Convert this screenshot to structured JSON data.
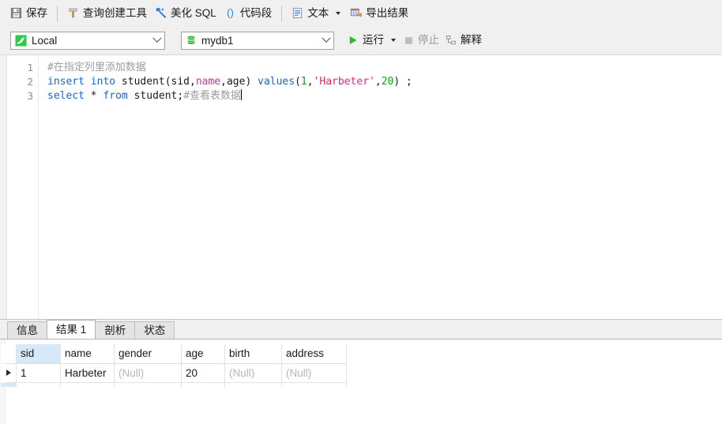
{
  "toolbar": {
    "items": [
      {
        "icon": "save-icon",
        "label": "保存"
      },
      {
        "icon": "query-builder-icon",
        "label": "查询创建工具"
      },
      {
        "icon": "beautify-icon",
        "label": "美化 SQL"
      },
      {
        "icon": "code-snippet-icon",
        "label": "代码段"
      },
      {
        "icon": "text-icon",
        "label": "文本"
      },
      {
        "icon": "export-result-icon",
        "label": "导出结果"
      }
    ]
  },
  "connection_bar": {
    "connection": {
      "icon": "mysql-dolphin-icon",
      "value": "Local"
    },
    "database": {
      "icon": "database-icon",
      "value": "mydb1"
    },
    "run_label": "运行",
    "stop_label": "停止",
    "explain_label": "解释"
  },
  "editor": {
    "line_numbers": [
      "1",
      "2",
      "3"
    ],
    "lines": [
      {
        "tokens": [
          {
            "t": "#在指定列里添加数据",
            "c": "comment"
          }
        ]
      },
      {
        "tokens": [
          {
            "t": "insert into",
            "c": "kw"
          },
          {
            "t": " student(sid,",
            "c": "plain"
          },
          {
            "t": "name",
            "c": "id"
          },
          {
            "t": ",age) ",
            "c": "plain"
          },
          {
            "t": "values",
            "c": "kw"
          },
          {
            "t": "(",
            "c": "plain"
          },
          {
            "t": "1",
            "c": "num"
          },
          {
            "t": ",",
            "c": "plain"
          },
          {
            "t": "'Harbeter'",
            "c": "str"
          },
          {
            "t": ",",
            "c": "plain"
          },
          {
            "t": "20",
            "c": "num"
          },
          {
            "t": ") ;",
            "c": "plain"
          }
        ]
      },
      {
        "tokens": [
          {
            "t": "select",
            "c": "kw"
          },
          {
            "t": " * ",
            "c": "plain"
          },
          {
            "t": "from",
            "c": "kw"
          },
          {
            "t": " student;",
            "c": "plain"
          },
          {
            "t": "#查看表数据",
            "c": "comment"
          }
        ]
      }
    ]
  },
  "result_panel": {
    "tabs": [
      {
        "label": "信息",
        "active": false
      },
      {
        "label": "结果 1",
        "active": true
      },
      {
        "label": "剖析",
        "active": false
      },
      {
        "label": "状态",
        "active": false
      }
    ],
    "grid": {
      "columns": [
        "sid",
        "name",
        "gender",
        "age",
        "birth",
        "address"
      ],
      "rows": [
        {
          "current": true,
          "cells": [
            {
              "v": "1",
              "type": "number"
            },
            {
              "v": "Harbeter",
              "type": "text"
            },
            {
              "v": "(Null)",
              "type": "null"
            },
            {
              "v": "20",
              "type": "number"
            },
            {
              "v": "(Null)",
              "type": "null"
            },
            {
              "v": "(Null)",
              "type": "null"
            }
          ]
        }
      ]
    }
  },
  "colors": {
    "accent_green": "#2eb82e",
    "keyword_blue": "#1166dd",
    "string_pink": "#e8276e",
    "number_green": "#12a112",
    "identifier_magenta": "#c42ea0",
    "comment_gray": "#9d9d9d",
    "header_highlight": "#d6e9fb",
    "toolbar_bg": "#f0f0f0"
  }
}
